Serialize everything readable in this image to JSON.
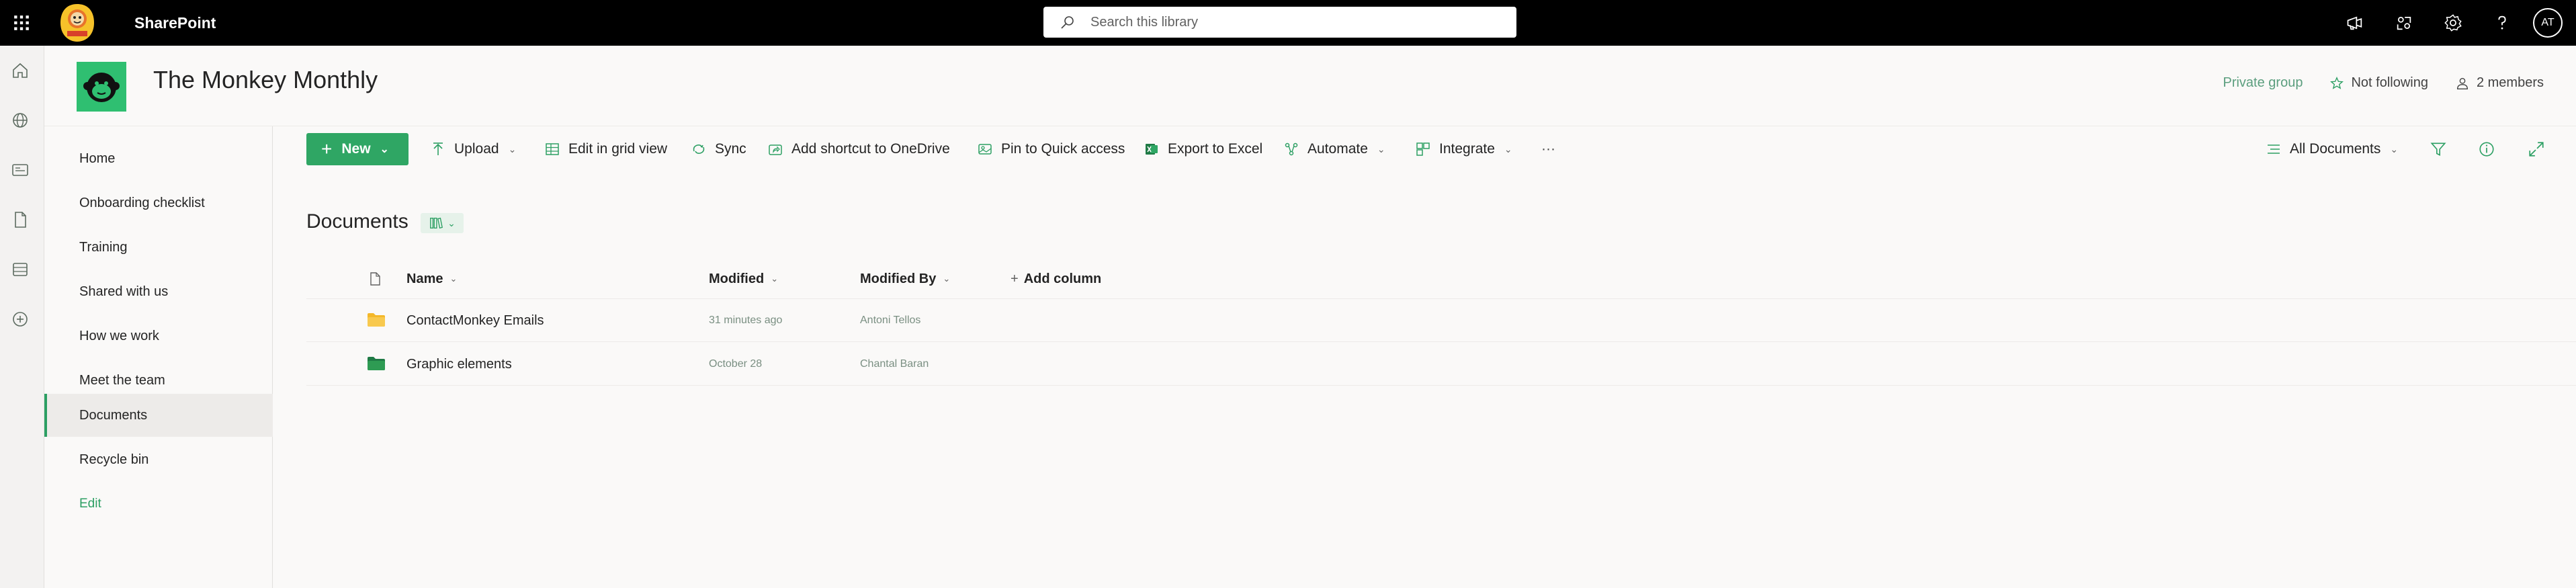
{
  "suite": {
    "app_name": "SharePoint",
    "search_placeholder": "Search this library",
    "avatar_initials": "AT"
  },
  "site": {
    "title": "The Monkey Monthly",
    "privacy": "Private group",
    "follow_label": "Not following",
    "members_label": "2 members"
  },
  "leftnav": {
    "items": [
      {
        "label": "Home"
      },
      {
        "label": "Onboarding checklist"
      },
      {
        "label": "Training"
      },
      {
        "label": "Shared with us"
      },
      {
        "label": "How we work"
      },
      {
        "label": "Meet the team"
      },
      {
        "label": "Documents"
      },
      {
        "label": "Recycle bin"
      },
      {
        "label": "Edit"
      }
    ],
    "active": "Documents"
  },
  "commandbar": {
    "new_label": "New",
    "upload_label": "Upload",
    "grid_label": "Edit in grid view",
    "sync_label": "Sync",
    "shortcut_label": "Add shortcut to OneDrive",
    "pin_label": "Pin to Quick access",
    "export_label": "Export to Excel",
    "automate_label": "Automate",
    "integrate_label": "Integrate",
    "more_label": "···",
    "view_label": "All Documents"
  },
  "library": {
    "title": "Documents",
    "columns": {
      "name": "Name",
      "modified": "Modified",
      "modified_by": "Modified By",
      "add_column": "Add column"
    },
    "rows": [
      {
        "name": "ContactMonkey Emails",
        "modified": "31 minutes ago",
        "modified_by": "Antoni Tellos",
        "folder_color": "#f4b82a"
      },
      {
        "name": "Graphic elements",
        "modified": "October 28",
        "modified_by": "Chantal Baran",
        "folder_color": "#2e9b53"
      }
    ]
  },
  "colors": {
    "accent": "#2fa664",
    "suitebar": "#000000"
  }
}
